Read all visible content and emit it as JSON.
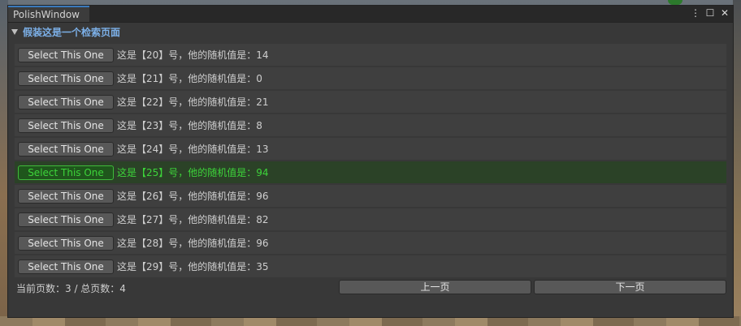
{
  "window": {
    "tab_title": "PolishWindow",
    "foldout_label": "假装这是一个检索页面"
  },
  "rows": [
    {
      "button": "Select This One",
      "text": "这是【20】号，他的随机值是：14",
      "selected": false
    },
    {
      "button": "Select This One",
      "text": "这是【21】号，他的随机值是：0",
      "selected": false
    },
    {
      "button": "Select This One",
      "text": "这是【22】号，他的随机值是：21",
      "selected": false
    },
    {
      "button": "Select This One",
      "text": "这是【23】号，他的随机值是：8",
      "selected": false
    },
    {
      "button": "Select This One",
      "text": "这是【24】号，他的随机值是：13",
      "selected": false
    },
    {
      "button": "Select This One",
      "text": "这是【25】号，他的随机值是：94",
      "selected": true
    },
    {
      "button": "Select This One",
      "text": "这是【26】号，他的随机值是：96",
      "selected": false
    },
    {
      "button": "Select This One",
      "text": "这是【27】号，他的随机值是：82",
      "selected": false
    },
    {
      "button": "Select This One",
      "text": "这是【28】号，他的随机值是：96",
      "selected": false
    },
    {
      "button": "Select This One",
      "text": "这是【29】号，他的随机值是：35",
      "selected": false
    }
  ],
  "pager": {
    "info": "当前页数：3 / 总页数：4",
    "prev_label": "上一页",
    "next_label": "下一页"
  },
  "colors": {
    "selected_text": "#3dd43a",
    "foldout_label": "#7cb0e8",
    "tab_accent": "#3a79bb"
  },
  "icons": [
    "kebab-menu-icon",
    "maximize-icon",
    "close-icon",
    "foldout-arrow-icon"
  ]
}
